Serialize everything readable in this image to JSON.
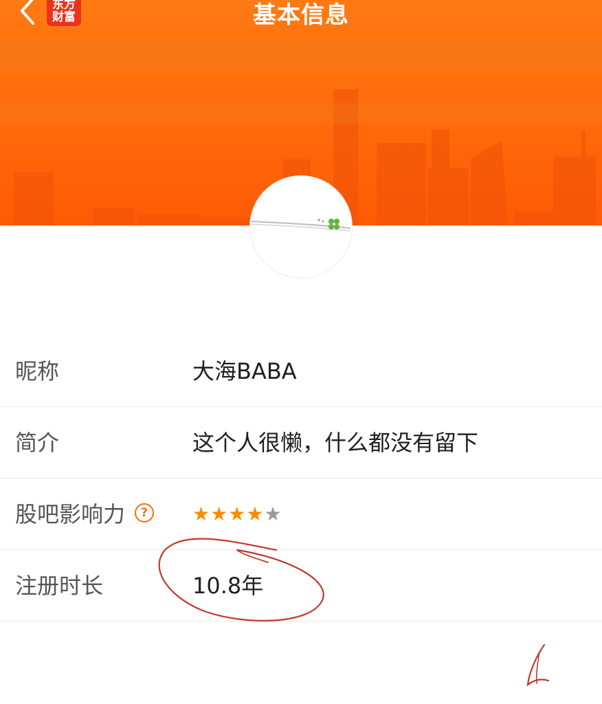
{
  "header": {
    "title": "基本信息",
    "brand_line1": "东方",
    "brand_line2": "财富",
    "back_icon": "chevron-left-icon",
    "banner_color": "#ff6a0a"
  },
  "profile": {
    "rows": [
      {
        "label": "昵称",
        "value": "大海BABA"
      },
      {
        "label": "简介",
        "value": "这个人很懒，什么都没有留下"
      },
      {
        "label": "股吧影响力",
        "help_icon": "?",
        "rating": 4,
        "rating_max": 5
      },
      {
        "label": "注册时长",
        "value": "10.8年"
      }
    ]
  },
  "colors": {
    "accent": "#ff6a0a",
    "star_on": "#ff8a00",
    "star_off": "#9a9a9a",
    "annotation": "#c0392b"
  }
}
